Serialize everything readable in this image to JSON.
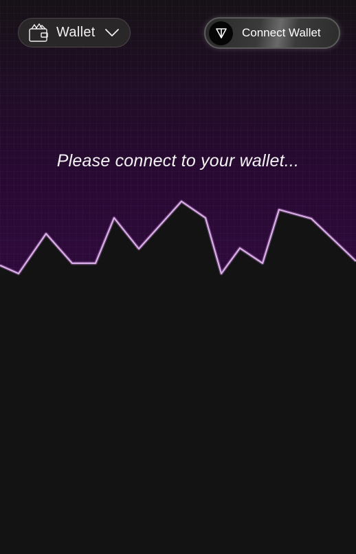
{
  "header": {
    "wallet_dropdown": {
      "label": "Wallet",
      "icon": "wallet-icon",
      "chevron_icon": "chevron-down-icon"
    },
    "connect_button": {
      "label": "Connect Wallet",
      "icon": "ton-logo-icon"
    }
  },
  "main": {
    "message": "Please connect to your wallet..."
  },
  "colors": {
    "background": "#131313",
    "accent_glow": "#2e0a3c",
    "line": "#d6a3e6"
  }
}
